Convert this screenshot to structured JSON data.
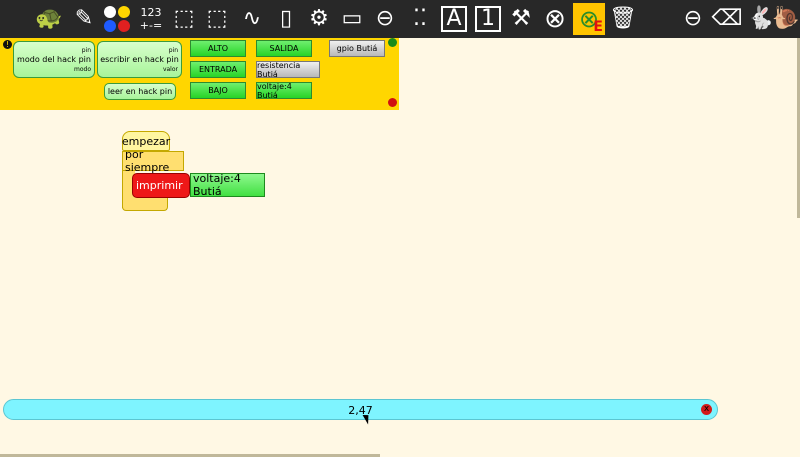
{
  "toolbar": {
    "buttons": [
      {
        "name": "turtle-icon",
        "glyph": "🐢"
      },
      {
        "name": "pen-icon",
        "glyph": "✎"
      },
      {
        "name": "colors-icon",
        "glyph": ""
      },
      {
        "name": "numbers-icon",
        "glyph": ""
      },
      {
        "name": "flow-icon",
        "glyph": "⬚"
      },
      {
        "name": "boxes-icon",
        "glyph": "⬚"
      },
      {
        "name": "actions-icon",
        "glyph": "∿"
      },
      {
        "name": "sensors-icon",
        "glyph": "▯"
      },
      {
        "name": "extras-icon",
        "glyph": "⚙"
      },
      {
        "name": "presentation-icon",
        "glyph": "▭"
      },
      {
        "name": "palette-icon",
        "glyph": "⊖"
      },
      {
        "name": "dots-icon",
        "glyph": "⁚⁚"
      },
      {
        "name": "font-icon",
        "glyph": "A"
      },
      {
        "name": "input-icon",
        "glyph": "1"
      },
      {
        "name": "butia-icon",
        "glyph": "⚒"
      },
      {
        "name": "stop-icon",
        "glyph": "⊗"
      },
      {
        "name": "error-icon",
        "glyph": "E"
      },
      {
        "name": "trash-icon",
        "glyph": "🗑"
      },
      {
        "name": "hide-icon",
        "glyph": "⊖"
      },
      {
        "name": "eraser-icon",
        "glyph": "⌫"
      },
      {
        "name": "rabbit-icon",
        "glyph": "🐇"
      },
      {
        "name": "snail-icon",
        "glyph": "🐌"
      }
    ],
    "numbers_top": "123",
    "numbers_bottom": "+-=",
    "colors": [
      "#ffffff",
      "#ffd600",
      "#1e5bff",
      "#e02020"
    ]
  },
  "palette": {
    "modo": {
      "label": "modo del hack pin",
      "pin": "pin",
      "modo": "modo"
    },
    "escribir": {
      "label": "escribir en hack pin",
      "pin": "pin",
      "valor": "valor"
    },
    "leer": {
      "label": "leer en hack pin"
    },
    "alto": "ALTO",
    "entrada": "ENTRADA",
    "bajo": "BAJO",
    "salida": "SALIDA",
    "resistencia": "resistencia Butiá",
    "voltaje": "voltaje:4 Butiá",
    "gpio": "gpio Butiá"
  },
  "canvas": {
    "empezar": "empezar",
    "por_siempre": "por siempre",
    "imprimir": "imprimir",
    "voltaje": "voltaje:4 Butiá"
  },
  "status": {
    "value": "2,47",
    "close": "x"
  }
}
